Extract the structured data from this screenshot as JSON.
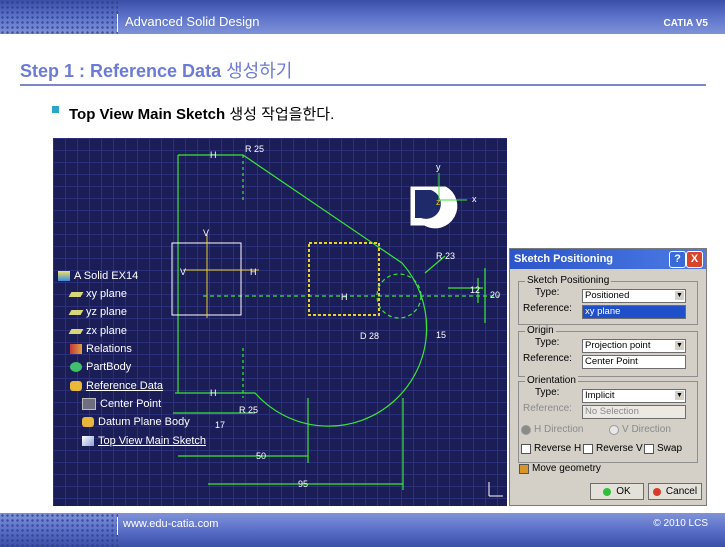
{
  "header": {
    "title": "Advanced Solid Design",
    "brand": "CATIA V5"
  },
  "step": {
    "prefix": "Step 1 : Reference Data ",
    "korean": "생성하기"
  },
  "instruction": {
    "bold": "Top View Main Sketch",
    "korean": " 생성 작업을한다."
  },
  "tree": {
    "root": "A Solid EX14",
    "items": [
      "xy plane",
      "yz plane",
      "zx plane",
      "Relations",
      "PartBody",
      "Reference Data",
      "Center Point",
      "Datum Plane Body",
      "Top View Main Sketch"
    ]
  },
  "sketch_labels": {
    "r25_top": "R 25",
    "r25_bottom": "R 25",
    "r23": "R 23",
    "d28": "D 28",
    "dim12": "12",
    "dim20": "20",
    "dim15": "15",
    "dim17": "17",
    "dim50": "50",
    "dim95": "95",
    "h_top": "H",
    "h_bottom": "H",
    "h_mid": "H",
    "v_left": "V",
    "v_axis": "V",
    "h_axis": "H",
    "compass_y": "y",
    "compass_x": "x",
    "compass_z": "z"
  },
  "dialog": {
    "title": "Sketch Positioning",
    "help": "?",
    "close": "X",
    "positioning": {
      "label": "Sketch Positioning",
      "type_label": "Type:",
      "type_value": "Positioned",
      "ref_label": "Reference:",
      "ref_value": "xy plane"
    },
    "origin": {
      "label": "Origin",
      "type_label": "Type:",
      "type_value": "Projection point",
      "ref_label": "Reference:",
      "ref_value": "Center Point"
    },
    "orientation": {
      "label": "Orientation",
      "type_label": "Type:",
      "type_value": "Implicit",
      "ref_label": "Reference:",
      "ref_value": "No Selection",
      "h_dir": "H Direction",
      "v_dir": "V Direction",
      "reverse_h": "Reverse H",
      "reverse_v": "Reverse V",
      "swap": "Swap"
    },
    "move_geometry": "Move geometry",
    "ok": "OK",
    "cancel": "Cancel"
  },
  "footer": {
    "url": "www.edu-catia.com",
    "copyright": "© 2010 LCS"
  },
  "colors": {
    "accent": "#6b7bd6",
    "sketch_green": "#39e639",
    "cad_bg": "#1b1d57",
    "highlight_yellow": "#e8d12a"
  }
}
